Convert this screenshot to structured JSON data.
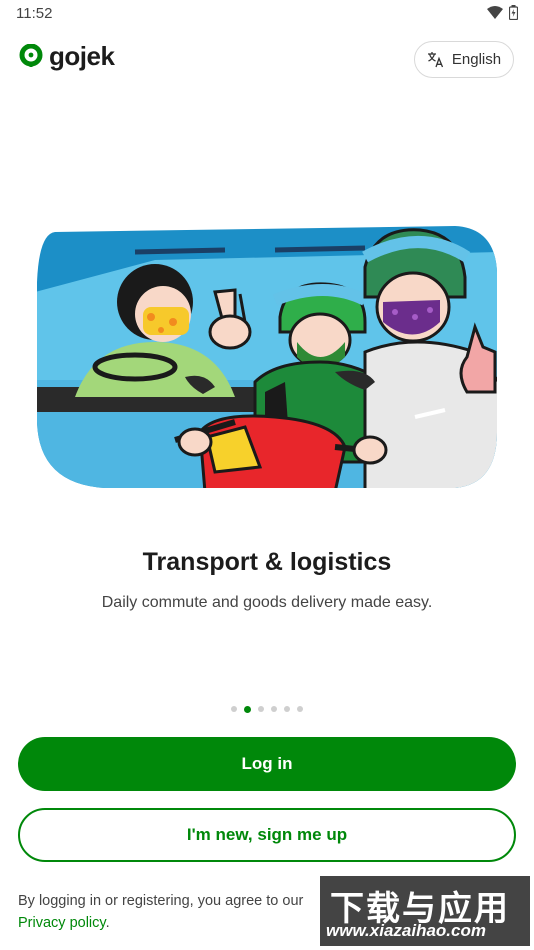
{
  "status_bar": {
    "time": "11:52"
  },
  "app": {
    "logo_text": "gojek",
    "brand_color": "#00880a"
  },
  "language_button": {
    "label": "English"
  },
  "onboarding": {
    "title": "Transport & logistics",
    "subtitle": "Daily commute and goods delivery made easy.",
    "page_indicator": {
      "total": 6,
      "active_index": 1
    }
  },
  "actions": {
    "login_label": "Log in",
    "signup_label": "I'm new, sign me up"
  },
  "legal": {
    "prefix": "By logging in or registering, you agree to our",
    "privacy_link": "Privacy policy",
    "suffix": "."
  },
  "watermark": {
    "top": "下载与应用",
    "bottom": "www.xiazaihao.com"
  }
}
